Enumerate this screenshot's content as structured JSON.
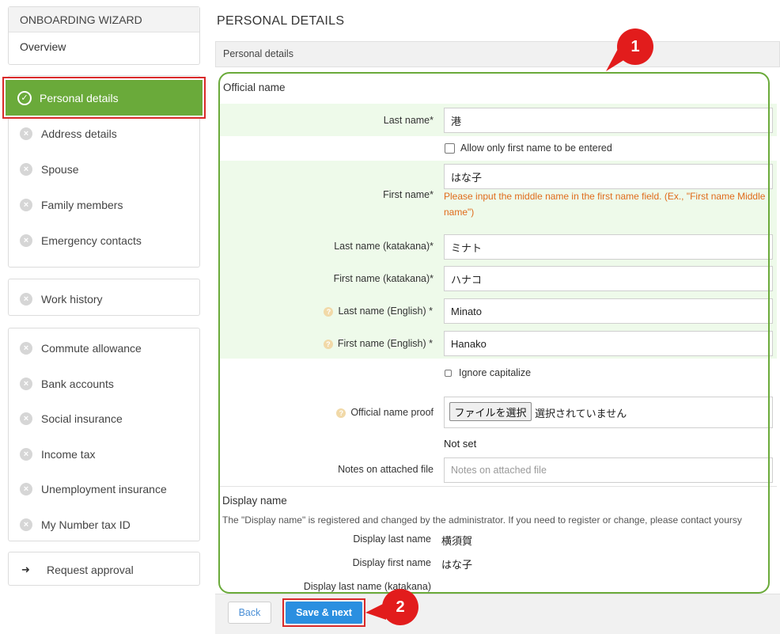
{
  "sidebar": {
    "header": "ONBOARDING WIZARD",
    "overview": "Overview",
    "active_item": "Personal details",
    "group1": [
      "Address details",
      "Spouse",
      "Family members",
      "Emergency contacts"
    ],
    "group2": [
      "Work history"
    ],
    "group3": [
      "Commute allowance",
      "Bank accounts",
      "Social insurance",
      "Income tax",
      "Unemployment insurance",
      "My Number tax ID"
    ],
    "request_approval": "Request approval"
  },
  "main": {
    "page_title": "PERSONAL DETAILS",
    "section_bar": "Personal details",
    "official_name_title": "Official name",
    "fields": {
      "last_name_label": "Last name*",
      "last_name_value": "港",
      "allow_first_only": "Allow only first name to be entered",
      "first_name_label": "First name*",
      "first_name_value": "はな子",
      "first_name_hint": "Please input the middle name in the first name field. (Ex., \"First name Middle name\")",
      "last_kana_label": "Last name (katakana)*",
      "last_kana_value": "ミナト",
      "first_kana_label": "First name (katakana)*",
      "first_kana_value": "ハナコ",
      "last_en_label": "Last name (English) *",
      "last_en_value": "Minato",
      "first_en_label": "First name (English) *",
      "first_en_value": "Hanako",
      "ignore_capitalize": "Ignore capitalize",
      "proof_label": "Official name proof",
      "file_button": "ファイルを選択",
      "file_status": "選択されていません",
      "not_set": "Not set",
      "notes_label": "Notes on attached file",
      "notes_placeholder": "Notes on attached file"
    },
    "display_name": {
      "title": "Display name",
      "note": "The \"Display name\" is registered and changed by the administrator. If you need to register or change, please contact yoursy",
      "last_label": "Display last name",
      "last_value": "横須賀",
      "first_label": "Display first name",
      "first_value": "はな子",
      "kana_label": "Display last name (katakana)"
    },
    "footer": {
      "back": "Back",
      "save_next": "Save & next"
    }
  },
  "callouts": {
    "one": "1",
    "two": "2"
  },
  "colors": {
    "accent_green": "#6aaa3a",
    "highlight_red": "#d92a2a",
    "primary_blue": "#2a8fe0",
    "hint_orange": "#e06b1b"
  }
}
